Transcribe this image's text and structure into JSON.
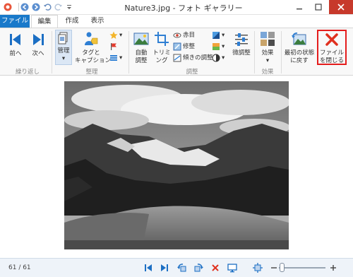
{
  "window": {
    "title": "Nature3.jpg - フォト ギャラリー"
  },
  "tabs": {
    "file": "ファイル",
    "edit": "編集",
    "create": "作成",
    "view": "表示"
  },
  "ribbon": {
    "prev": "前へ",
    "next": "次へ",
    "manage": "管理",
    "tag_caption_1": "タグと",
    "tag_caption_2": "キャプション",
    "auto_adjust_1": "自動",
    "auto_adjust_2": "調整",
    "trim_1": "トリミ",
    "trim_2": "ング",
    "red_eye": "赤目",
    "retouch": "修整",
    "straighten": "傾きの調整",
    "fine_tune": "微調整",
    "effects": "効果",
    "revert_1": "最初の状態",
    "revert_2": "に戻す",
    "close_file_1": "ファイル",
    "close_file_2": "を閉じる",
    "groups": {
      "repeat": "繰り返し",
      "organize": "整理",
      "adjust": "調整",
      "effects": "効果"
    }
  },
  "status": {
    "counter": "61 / 61"
  },
  "colors": {
    "file_tab": "#1979ca",
    "accent_blue": "#1c6fc4",
    "close_red": "#e41c1c"
  }
}
